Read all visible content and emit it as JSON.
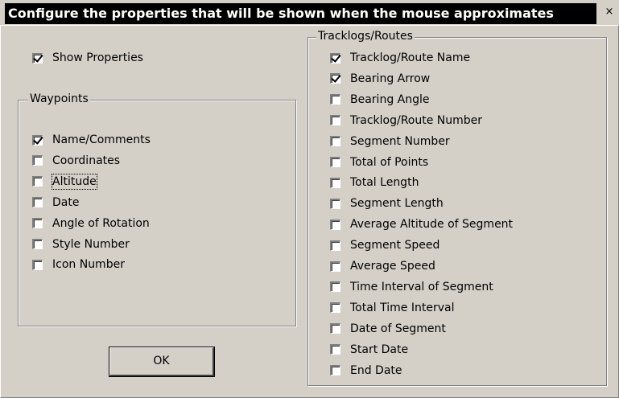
{
  "window": {
    "title": "Configure the properties that will be shown when the mouse approximates",
    "close_glyph": "×"
  },
  "show_properties": {
    "label": "Show Properties",
    "checked": true
  },
  "waypoints": {
    "title": "Waypoints",
    "items": [
      {
        "label": "Name/Comments",
        "checked": true
      },
      {
        "label": "Coordinates",
        "checked": false
      },
      {
        "label": "Altitude",
        "checked": false,
        "focused": true
      },
      {
        "label": "Date",
        "checked": false
      },
      {
        "label": "Angle of Rotation",
        "checked": false
      },
      {
        "label": "Style Number",
        "checked": false
      },
      {
        "label": "Icon Number",
        "checked": false
      }
    ]
  },
  "tracklogs": {
    "title": "Tracklogs/Routes",
    "items": [
      {
        "label": "Tracklog/Route Name",
        "checked": true
      },
      {
        "label": "Bearing Arrow",
        "checked": true
      },
      {
        "label": "Bearing Angle",
        "checked": false
      },
      {
        "label": "Tracklog/Route Number",
        "checked": false
      },
      {
        "label": "Segment Number",
        "checked": false
      },
      {
        "label": "Total of Points",
        "checked": false
      },
      {
        "label": "Total Length",
        "checked": false
      },
      {
        "label": "Segment Length",
        "checked": false
      },
      {
        "label": "Average Altitude of Segment",
        "checked": false
      },
      {
        "label": "Segment Speed",
        "checked": false
      },
      {
        "label": "Average Speed",
        "checked": false
      },
      {
        "label": "Time Interval of Segment",
        "checked": false
      },
      {
        "label": "Total Time Interval",
        "checked": false
      },
      {
        "label": "Date of Segment",
        "checked": false
      },
      {
        "label": "Start Date",
        "checked": false
      },
      {
        "label": "End Date",
        "checked": false
      }
    ]
  },
  "buttons": {
    "ok_label": "OK"
  },
  "colors": {
    "face": "#d4d0c8",
    "title_bg": "#000000",
    "title_fg": "#ffffff"
  }
}
